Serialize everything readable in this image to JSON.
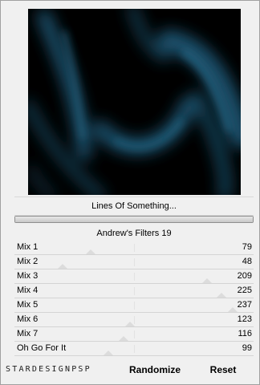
{
  "filter": {
    "name": "Lines Of Something...",
    "category": "Andrew's Filters 19"
  },
  "progress": {
    "fraction": 1.0
  },
  "sliders": [
    {
      "label": "Mix 1",
      "value": "79"
    },
    {
      "label": "Mix 2",
      "value": "48"
    },
    {
      "label": "Mix 3",
      "value": "209"
    },
    {
      "label": "Mix 4",
      "value": "225"
    },
    {
      "label": "Mix 5",
      "value": "237"
    },
    {
      "label": "Mix 6",
      "value": "123"
    },
    {
      "label": "Mix 7",
      "value": "116"
    },
    {
      "label": "Oh Go For It",
      "value": "99"
    }
  ],
  "slider_max": 255,
  "footer": {
    "brand": "STARDESIGNPSP",
    "randomize_label": "Randomize",
    "reset_label": "Reset"
  },
  "colors": {
    "preview_dark": "#000000",
    "preview_blue": "#1e5a78"
  }
}
